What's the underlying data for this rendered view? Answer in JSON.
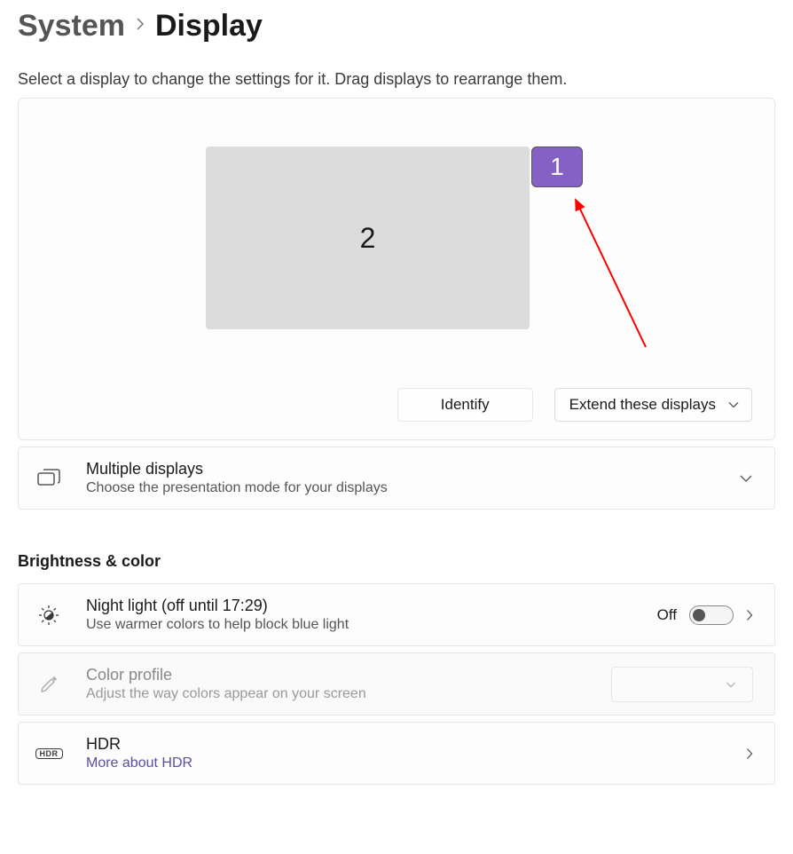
{
  "breadcrumb": {
    "parent": "System",
    "current": "Display"
  },
  "subtitle": "Select a display to change the settings for it. Drag displays to rearrange them.",
  "monitors": {
    "primary_label": "1",
    "secondary_label": "2"
  },
  "arrangement": {
    "identify_label": "Identify",
    "mode_label": "Extend these displays"
  },
  "multiple_displays": {
    "title": "Multiple displays",
    "subtitle": "Choose the presentation mode for your displays"
  },
  "section_brightness": "Brightness & color",
  "night_light": {
    "title": "Night light (off until 17:29)",
    "subtitle": "Use warmer colors to help block blue light",
    "state_label": "Off"
  },
  "color_profile": {
    "title": "Color profile",
    "subtitle": "Adjust the way colors appear on your screen"
  },
  "hdr": {
    "title": "HDR",
    "link": "More about HDR",
    "badge": "HDR"
  }
}
